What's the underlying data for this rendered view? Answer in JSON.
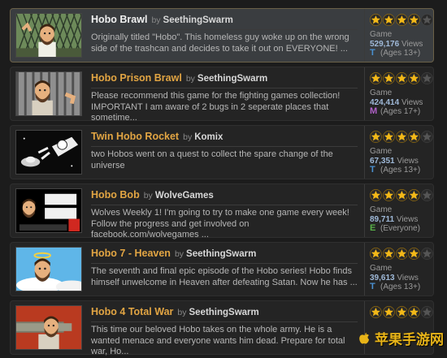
{
  "by_label": "by",
  "items": [
    {
      "title": "Hobo Brawl",
      "author": "SeethingSwarm",
      "description": "Originally titled \"Hobo\". This homeless guy woke up on the wrong side of the trashcan and decides to take it out on EVERYONE! ...",
      "stars": 4,
      "category": "Game",
      "views": "529,176",
      "views_label": "Views",
      "rating_letter": "T",
      "rating_text": "(Ages 13+)",
      "rating_color": "#4a90d0",
      "selected": true
    },
    {
      "title": "Hobo Prison Brawl",
      "author": "SeethingSwarm",
      "description": "Please recommend this game for the fighting games collection! IMPORTANT I am aware of 2 bugs in 2 seperate places that sometime...",
      "stars": 4,
      "category": "Game",
      "views": "424,414",
      "views_label": "Views",
      "rating_letter": "M",
      "rating_text": "(Ages 17+)",
      "rating_color": "#b060c8",
      "selected": false
    },
    {
      "title": "Twin Hobo Rocket",
      "author": "Komix",
      "description": "two Hobos went on a quest to collect the spare change of the universe",
      "stars": 4,
      "category": "Game",
      "views": "67,351",
      "views_label": "Views",
      "rating_letter": "T",
      "rating_text": "(Ages 13+)",
      "rating_color": "#4a90d0",
      "selected": false
    },
    {
      "title": "Hobo Bob",
      "author": "WolveGames",
      "description": "Wolves Weekly 1! I'm going to try to make one game every week! Follow the progress and get involved on facebook.com/wolvegames ...",
      "stars": 4,
      "category": "Game",
      "views": "89,711",
      "views_label": "Views",
      "rating_letter": "E",
      "rating_text": "(Everyone)",
      "rating_color": "#58b048",
      "selected": false
    },
    {
      "title": "Hobo 7 - Heaven",
      "author": "SeethingSwarm",
      "description": "The seventh and final epic episode of the Hobo series! Hobo finds himself unwelcome in Heaven after defeating Satan. Now he has ...",
      "stars": 4,
      "category": "Game",
      "views": "39,613",
      "views_label": "Views",
      "rating_letter": "T",
      "rating_text": "(Ages 13+)",
      "rating_color": "#4a90d0",
      "selected": false
    },
    {
      "title": "Hobo 4 Total War",
      "author": "SeethingSwarm",
      "description": "This time our beloved Hobo takes on the whole army. He is a wanted menace and everyone wants him dead. Prepare for total war, Ho...",
      "stars": 4,
      "category": "",
      "views": "",
      "views_label": "",
      "rating_letter": "",
      "rating_text": "",
      "rating_color": "#4a90d0",
      "selected": false
    }
  ],
  "watermark": "苹果手游网",
  "star_color_full": "#f2b818",
  "star_color_empty": "#555555"
}
